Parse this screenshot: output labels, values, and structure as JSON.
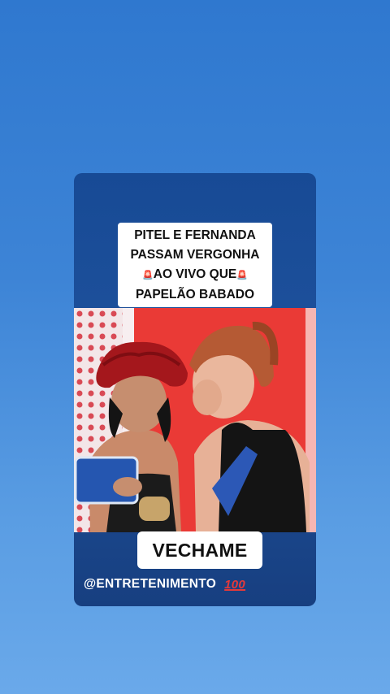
{
  "headline": {
    "line1": "PITEL E FERNANDA",
    "line2": "PASSAM VERGONHA",
    "line3_prefix_icon": "siren-emoji",
    "line3": "AO VIVO QUE",
    "line3_suffix_icon": "siren-emoji",
    "line4": "PAPELÃO BABADO"
  },
  "caption": "VECHAME",
  "handle": {
    "text": "@ENTRETENIMENTO",
    "icon": "hundred-points-emoji",
    "icon_text": "100"
  },
  "colors": {
    "background": "#3d84d6",
    "card": "#1c4f9a",
    "label_bg": "#ffffff",
    "siren": "#d1262b"
  }
}
